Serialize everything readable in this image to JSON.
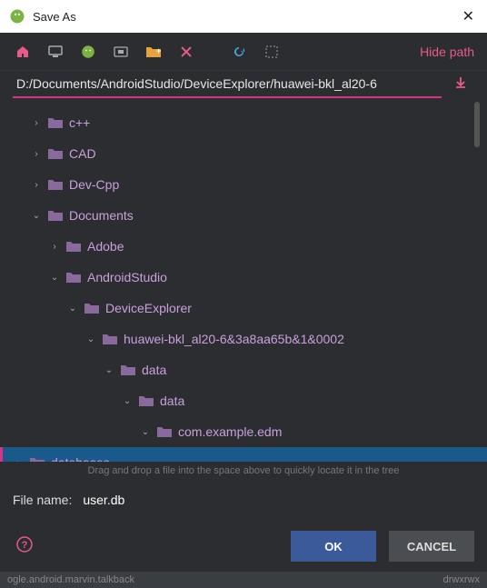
{
  "title": "Save As",
  "toolbar": {
    "hide_path": "Hide path"
  },
  "path": "D:/Documents/AndroidStudio/DeviceExplorer/huawei-bkl_al20-6",
  "tree": [
    {
      "label": "c++",
      "depth": 1,
      "expanded": false
    },
    {
      "label": "CAD",
      "depth": 1,
      "expanded": false
    },
    {
      "label": "Dev-Cpp",
      "depth": 1,
      "expanded": false
    },
    {
      "label": "Documents",
      "depth": 1,
      "expanded": true
    },
    {
      "label": "Adobe",
      "depth": 2,
      "expanded": false
    },
    {
      "label": "AndroidStudio",
      "depth": 2,
      "expanded": true
    },
    {
      "label": "DeviceExplorer",
      "depth": 3,
      "expanded": true
    },
    {
      "label": "huawei-bkl_al20-6&3a8aa65b&1&0002",
      "depth": 4,
      "expanded": true
    },
    {
      "label": "data",
      "depth": 5,
      "expanded": true
    },
    {
      "label": "data",
      "depth": 6,
      "expanded": true
    },
    {
      "label": "com.example.edm",
      "depth": 7,
      "expanded": true
    },
    {
      "label": "databases",
      "depth": 8,
      "expanded": false,
      "selected": true
    }
  ],
  "drag_hint": "Drag and drop a file into the space above to quickly locate it in the tree",
  "file_name": {
    "label": "File name:",
    "value": "user.db"
  },
  "buttons": {
    "ok": "OK",
    "cancel": "CANCEL"
  },
  "bottom": {
    "left": "ogle.android.marvin.talkback",
    "right": "drwxrwx"
  }
}
